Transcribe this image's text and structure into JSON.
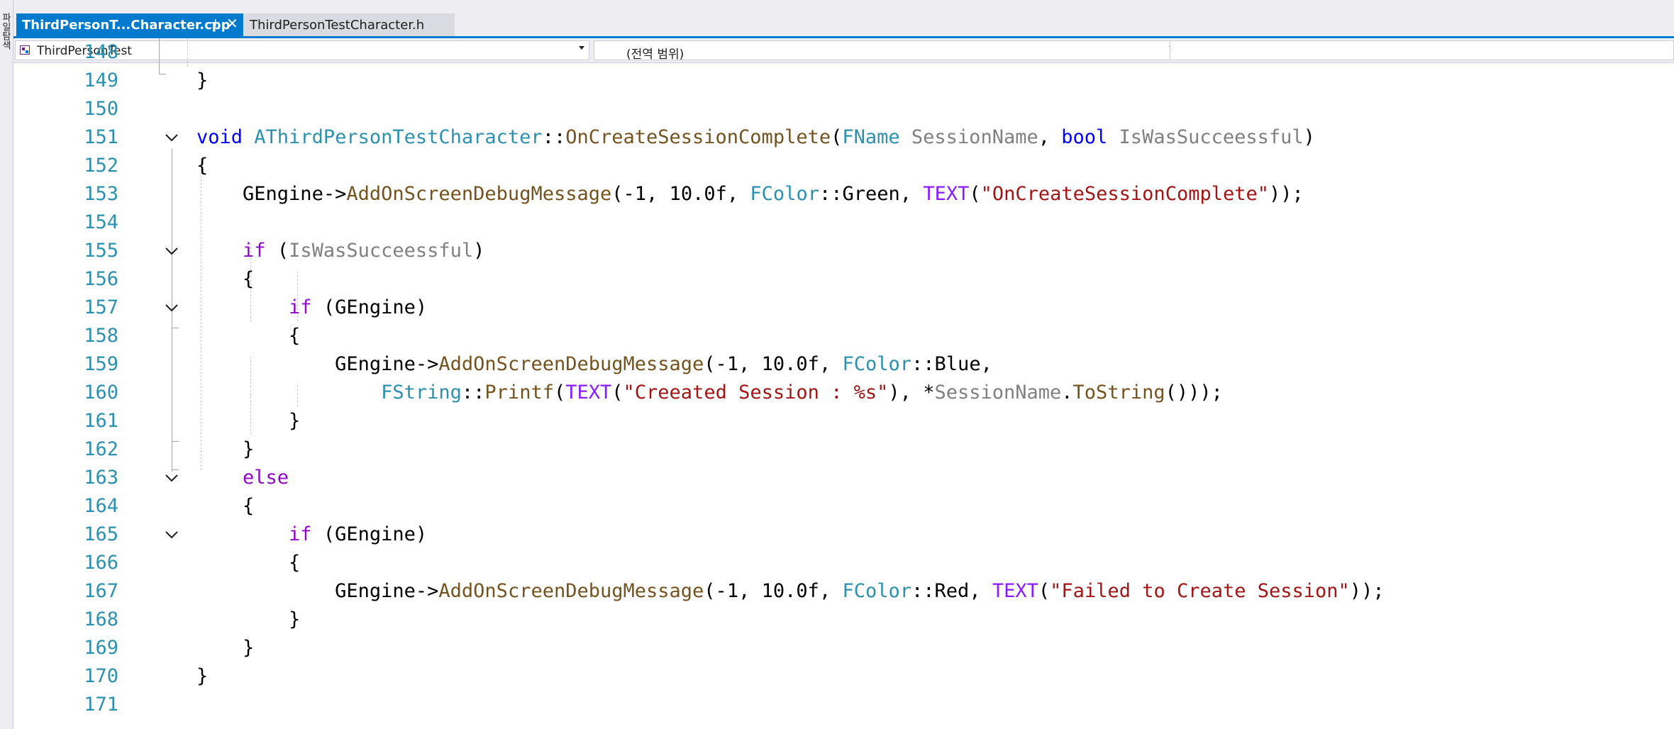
{
  "left_strip": {
    "text": "파일탐색"
  },
  "tabs": [
    {
      "label": "ThirdPersonT...Character.cpp",
      "active": true,
      "pin_glyph": "⊣",
      "close_glyph": "✕"
    },
    {
      "label": "ThirdPersonTestCharacter.h",
      "active": false
    }
  ],
  "navbar": {
    "project": "ThirdPersonTest",
    "scope": "(전역 범위)",
    "member": ""
  },
  "colors": {
    "accent": "#007acc",
    "keyword": "#0000ff",
    "control": "#8f08c4",
    "type": "#2b91af",
    "function": "#74531f",
    "parameter": "#808080",
    "string": "#a31515",
    "macro": "#8a1bff",
    "line_number": "#2b91af"
  },
  "editor": {
    "lines": [
      {
        "n": "148",
        "code": ""
      },
      {
        "n": "149",
        "code": "}"
      },
      {
        "n": "150",
        "code": ""
      },
      {
        "n": "151",
        "code": "void AThirdPersonTestCharacter::OnCreateSessionComplete(FName SessionName, bool IsWasSucceessful)"
      },
      {
        "n": "152",
        "code": "{"
      },
      {
        "n": "153",
        "code": "    GEngine->AddOnScreenDebugMessage(-1, 10.0f, FColor::Green, TEXT(\"OnCreateSessionComplete\"));"
      },
      {
        "n": "154",
        "code": ""
      },
      {
        "n": "155",
        "code": "    if (IsWasSucceessful)"
      },
      {
        "n": "156",
        "code": "    {"
      },
      {
        "n": "157",
        "code": "        if (GEngine)"
      },
      {
        "n": "158",
        "code": "        {"
      },
      {
        "n": "159",
        "code": "            GEngine->AddOnScreenDebugMessage(-1, 10.0f, FColor::Blue,"
      },
      {
        "n": "160",
        "code": "                FString::Printf(TEXT(\"Creeated Session : %s\"), *SessionName.ToString()));"
      },
      {
        "n": "161",
        "code": "        }"
      },
      {
        "n": "162",
        "code": "    }"
      },
      {
        "n": "163",
        "code": "    else"
      },
      {
        "n": "164",
        "code": "    {"
      },
      {
        "n": "165",
        "code": "        if (GEngine)"
      },
      {
        "n": "166",
        "code": "        {"
      },
      {
        "n": "167",
        "code": "            GEngine->AddOnScreenDebugMessage(-1, 10.0f, FColor::Red, TEXT(\"Failed to Create Session\"));"
      },
      {
        "n": "168",
        "code": "        }"
      },
      {
        "n": "169",
        "code": "    }"
      },
      {
        "n": "170",
        "code": "}"
      },
      {
        "n": "171",
        "code": ""
      }
    ],
    "fold_lines": [
      "151",
      "155",
      "157",
      "163",
      "165"
    ]
  }
}
